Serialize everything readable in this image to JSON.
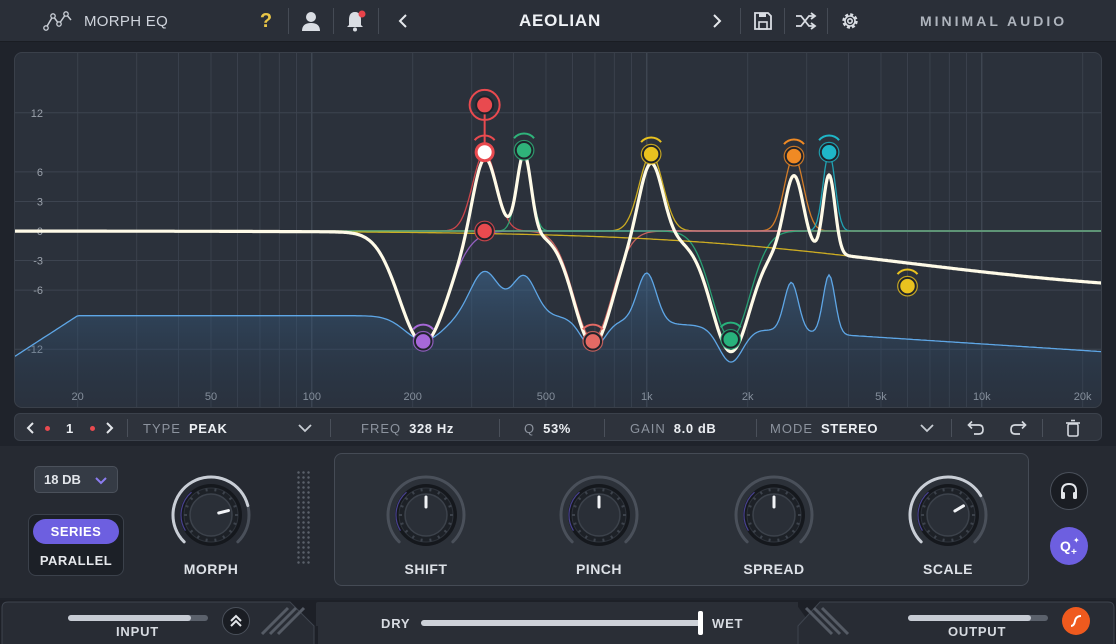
{
  "header": {
    "plugin_name": "MORPH EQ",
    "preset_name": "AEOLIAN",
    "brand": "MINIMAL AUDIO",
    "icons": [
      "eq-logo-icon",
      "help-icon",
      "user-icon",
      "bell-icon",
      "prev-preset-icon",
      "next-preset-icon",
      "save-icon",
      "shuffle-icon",
      "settings-icon"
    ],
    "colors": {
      "help": "#e8c547",
      "notification_dot": "#e8434a"
    }
  },
  "eq": {
    "db_labels": [
      "12",
      "6",
      "3",
      "0",
      "-3",
      "-6",
      "-12"
    ],
    "freq_labels": [
      "20",
      "50",
      "100",
      "200",
      "500",
      "1k",
      "2k",
      "5k",
      "10k",
      "20k"
    ],
    "band_colors": [
      "#e94a4f",
      "#2fb37a",
      "#e9c21f",
      "#f08a24",
      "#1fb6c8",
      "#a668d8",
      "#e46a64",
      "#28b27c",
      "#e9c21f"
    ],
    "curve_color": "#ffffff",
    "spectrum_color": "#5ea6e6"
  },
  "band_bar": {
    "band_number": "1",
    "type_label": "TYPE",
    "type_value": "PEAK",
    "freq_label": "FREQ",
    "freq_value": "328 Hz",
    "q_label": "Q",
    "q_value": "53%",
    "gain_label": "GAIN",
    "gain_value": "8.0 dB",
    "mode_label": "MODE",
    "mode_value": "STEREO"
  },
  "controls": {
    "slope": "18 DB",
    "routing": {
      "series": "SERIES",
      "parallel": "PARALLEL",
      "selected": "SERIES"
    },
    "knobs": [
      {
        "label": "MORPH",
        "value": 0.78
      },
      {
        "label": "SHIFT",
        "value": 0.5
      },
      {
        "label": "PINCH",
        "value": 0.5
      },
      {
        "label": "SPREAD",
        "value": 0.5
      },
      {
        "label": "SCALE",
        "value": 0.72
      }
    ]
  },
  "bottom": {
    "input_label": "INPUT",
    "dry_label": "DRY",
    "wet_label": "WET",
    "output_label": "OUTPUT",
    "dry_wet": 1.0,
    "input_level": 0.88,
    "output_level": 0.88
  }
}
